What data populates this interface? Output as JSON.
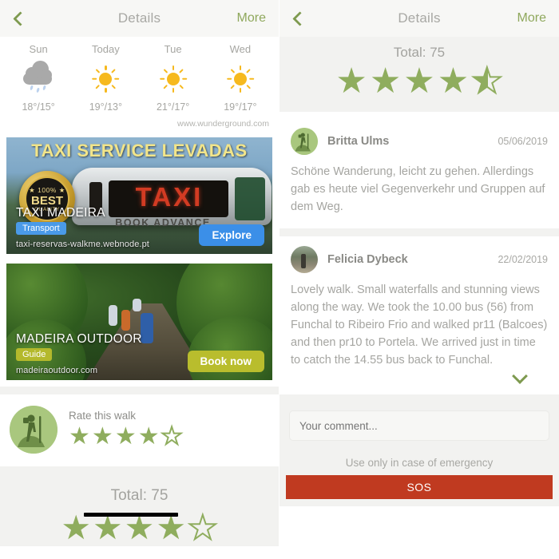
{
  "left": {
    "nav": {
      "back_icon": "chevron-left-icon",
      "title": "Details",
      "more_label": "More"
    },
    "weather": {
      "source": "www.wunderground.com",
      "days": [
        {
          "day": "Sun",
          "icon": "rain-cloud-icon",
          "temp": "18°/15°"
        },
        {
          "day": "Today",
          "icon": "sun-icon",
          "temp": "19°/13°"
        },
        {
          "day": "Tue",
          "icon": "sun-icon",
          "temp": "21°/17°"
        },
        {
          "day": "Wed",
          "icon": "sun-icon",
          "temp": "19°/17°"
        }
      ]
    },
    "ads": [
      {
        "headline": "TAXI SERVICE LEVADAS",
        "badge_top": "★ 100% ★",
        "badge_main": "BEST",
        "badge_sub": "QUALITY",
        "sign_word": "TAXI",
        "sign_sub": "BOOK ADVANCE",
        "brand": "TAXI MADEIRA",
        "tag": "Transport",
        "tag_color": "#4a9ae8",
        "url": "taxi-reservas-walkme.webnode.pt",
        "cta": "Explore",
        "cta_color": "#3b8fe8"
      },
      {
        "brand": "MADEIRA OUTDOOR",
        "tag": "Guide",
        "tag_color": "#b4b92c",
        "url": "madeiraoutdoor.com",
        "cta": "Book now",
        "cta_color": "#b9bd2d"
      }
    ],
    "rate": {
      "avatar_icon": "hiker-avatar-icon",
      "label": "Rate this walk",
      "stars_filled": 4,
      "stars_total": 5
    },
    "total": {
      "label": "Total: 75",
      "stars_filled": 4,
      "stars_total": 5
    }
  },
  "right": {
    "nav": {
      "back_icon": "chevron-left-icon",
      "title": "Details",
      "more_label": "More"
    },
    "total": {
      "label": "Total: 75",
      "stars_filled": 4,
      "stars_half": 1,
      "stars_total": 5
    },
    "reviews": [
      {
        "avatar": "hiker-avatar-icon",
        "name": "Britta Ulms",
        "date": "05/06/2019",
        "text": "Schöne Wanderung, leicht zu gehen. Allerdings gab es heute viel Gegenverkehr und Gruppen auf dem Weg."
      },
      {
        "avatar": "photo-avatar",
        "name": "Felicia Dybeck",
        "date": "22/02/2019",
        "text": "Lovely walk. Small waterfalls and stunning views along the way. We took the 10.00 bus (56) from Funchal to Ribeiro Frio and walked pr11 (Balcoes) and then pr10 to Portela. We arrived just in time to catch the 14.55 bus back to Funchal."
      }
    ],
    "expand_icon": "chevron-down-icon",
    "comment": {
      "placeholder": "Your comment..."
    },
    "sos": {
      "note": "Use only in case of emergency",
      "label": "SOS",
      "color": "#c03a20"
    }
  },
  "theme": {
    "accent_green": "#8fad5e",
    "nav_green": "#7e9a4f",
    "grey_bg": "#f2f2f0",
    "text_grey": "#a5a5a1"
  }
}
